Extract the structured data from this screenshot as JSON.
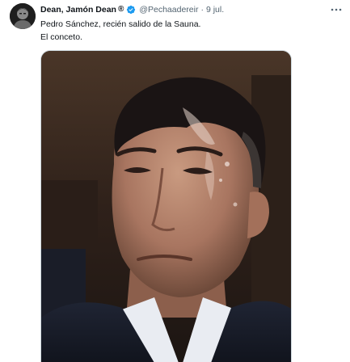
{
  "tweet": {
    "author": {
      "display_name": "Dean, Jamón Dean",
      "registered_mark": "®",
      "verified_icon": "verified-badge-icon",
      "handle": "@Pechaadereir",
      "separator": "·",
      "date": "9 jul."
    },
    "text_lines": [
      "Pedro Sánchez, recién salido de la Sauna.",
      "El conceto."
    ],
    "media": {
      "type": "photo",
      "icon": "photo"
    },
    "more_icon": "more-icon"
  },
  "colors": {
    "verified_blue": "#1d9bf0",
    "secondary_text": "#536471",
    "primary_text": "#0f1419"
  }
}
